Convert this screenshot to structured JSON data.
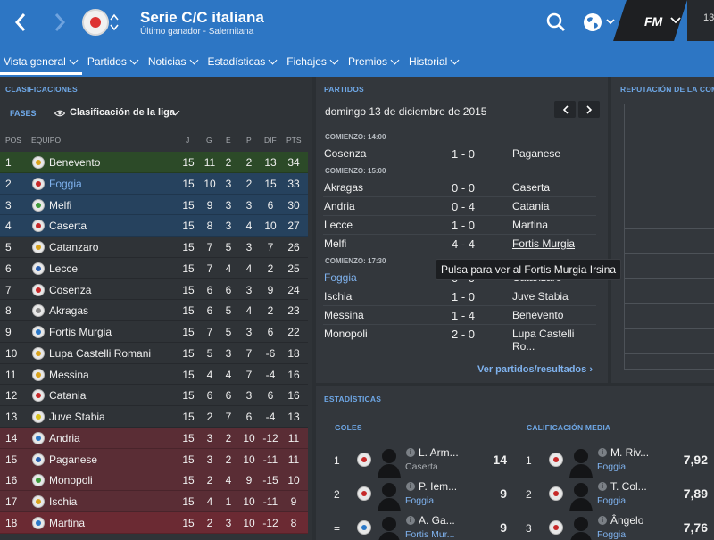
{
  "header": {
    "title": "Serie C/C italiana",
    "subtitle": "Último ganador - Salernitana",
    "fm_logo": "FM",
    "right_number": "13",
    "back_icon": "chevron-left-icon",
    "forward_icon": "chevron-right-icon",
    "search_icon": "search-icon",
    "globe_icon": "globe-icon",
    "accent_color": "#2d76c4"
  },
  "tabs": [
    {
      "label": "Vista general",
      "active": true
    },
    {
      "label": "Partidos",
      "active": false
    },
    {
      "label": "Noticias",
      "active": false
    },
    {
      "label": "Estadísticas",
      "active": false
    },
    {
      "label": "Fichajes",
      "active": false
    },
    {
      "label": "Premios",
      "active": false
    },
    {
      "label": "Historial",
      "active": false
    }
  ],
  "standings": {
    "heading": "CLASIFICACIONES",
    "fases_label": "FASES",
    "selector_label": "Clasificación de la liga",
    "columns": {
      "pos": "POS",
      "team": "EQUIPO",
      "j": "J",
      "g": "G",
      "e": "E",
      "p": "P",
      "dif": "DIF",
      "pts": "PTS"
    },
    "rows": [
      {
        "pos": "1",
        "team": "Benevento",
        "j": "15",
        "g": "11",
        "e": "2",
        "p": "2",
        "dif": "13",
        "pts": "34",
        "zone": "promo",
        "team_color": "#d9a21c",
        "link": false
      },
      {
        "pos": "2",
        "team": "Foggia",
        "j": "15",
        "g": "10",
        "e": "3",
        "p": "2",
        "dif": "15",
        "pts": "33",
        "zone": "playoff",
        "team_color": "#c62828",
        "link": true
      },
      {
        "pos": "3",
        "team": "Melfi",
        "j": "15",
        "g": "9",
        "e": "3",
        "p": "3",
        "dif": "6",
        "pts": "30",
        "zone": "playoff",
        "team_color": "#3f9a3a",
        "link": false
      },
      {
        "pos": "4",
        "team": "Caserta",
        "j": "15",
        "g": "8",
        "e": "3",
        "p": "4",
        "dif": "10",
        "pts": "27",
        "zone": "playoff",
        "team_color": "#c62828",
        "link": false
      },
      {
        "pos": "5",
        "team": "Catanzaro",
        "j": "15",
        "g": "7",
        "e": "5",
        "p": "3",
        "dif": "7",
        "pts": "26",
        "zone": "normal",
        "team_color": "#d9a21c",
        "link": false
      },
      {
        "pos": "6",
        "team": "Lecce",
        "j": "15",
        "g": "7",
        "e": "4",
        "p": "4",
        "dif": "2",
        "pts": "25",
        "zone": "normal",
        "team_color": "#2a5fb0",
        "link": false
      },
      {
        "pos": "7",
        "team": "Cosenza",
        "j": "15",
        "g": "6",
        "e": "6",
        "p": "3",
        "dif": "9",
        "pts": "24",
        "zone": "normal",
        "team_color": "#c62828",
        "link": false
      },
      {
        "pos": "8",
        "team": "Akragas",
        "j": "15",
        "g": "6",
        "e": "5",
        "p": "4",
        "dif": "2",
        "pts": "23",
        "zone": "normal",
        "team_color": "#888888",
        "link": false
      },
      {
        "pos": "9",
        "team": "Fortis Murgia",
        "j": "15",
        "g": "7",
        "e": "5",
        "p": "3",
        "dif": "6",
        "pts": "22",
        "zone": "normal",
        "team_color": "#2a78c8",
        "link": false
      },
      {
        "pos": "10",
        "team": "Lupa Castelli Romani",
        "j": "15",
        "g": "5",
        "e": "3",
        "p": "7",
        "dif": "-6",
        "pts": "18",
        "zone": "normal",
        "team_color": "#d9a21c",
        "link": false
      },
      {
        "pos": "11",
        "team": "Messina",
        "j": "15",
        "g": "4",
        "e": "4",
        "p": "7",
        "dif": "-4",
        "pts": "16",
        "zone": "normal",
        "team_color": "#d9a21c",
        "link": false
      },
      {
        "pos": "12",
        "team": "Catania",
        "j": "15",
        "g": "6",
        "e": "6",
        "p": "3",
        "dif": "6",
        "pts": "16",
        "zone": "normal",
        "team_color": "#c62828",
        "link": false
      },
      {
        "pos": "13",
        "team": "Juve Stabia",
        "j": "15",
        "g": "2",
        "e": "7",
        "p": "6",
        "dif": "-4",
        "pts": "13",
        "zone": "normal",
        "team_color": "#d9c21c",
        "link": false
      },
      {
        "pos": "14",
        "team": "Andria",
        "j": "15",
        "g": "3",
        "e": "2",
        "p": "10",
        "dif": "-12",
        "pts": "11",
        "zone": "rel",
        "team_color": "#2a78c8",
        "link": false
      },
      {
        "pos": "15",
        "team": "Paganese",
        "j": "15",
        "g": "3",
        "e": "2",
        "p": "10",
        "dif": "-11",
        "pts": "11",
        "zone": "rel",
        "team_color": "#2a5fb0",
        "link": false
      },
      {
        "pos": "16",
        "team": "Monopoli",
        "j": "15",
        "g": "2",
        "e": "4",
        "p": "9",
        "dif": "-15",
        "pts": "10",
        "zone": "rel",
        "team_color": "#3f9a3a",
        "link": false
      },
      {
        "pos": "17",
        "team": "Ischia",
        "j": "15",
        "g": "4",
        "e": "1",
        "p": "10",
        "dif": "-11",
        "pts": "9",
        "zone": "rel",
        "team_color": "#d9a21c",
        "link": false
      },
      {
        "pos": "18",
        "team": "Martina",
        "j": "15",
        "g": "2",
        "e": "3",
        "p": "10",
        "dif": "-12",
        "pts": "8",
        "zone": "rel2",
        "team_color": "#2a78c8",
        "link": false
      }
    ]
  },
  "matches": {
    "heading": "PARTIDOS",
    "date": "domingo 13 de diciembre de 2015",
    "groups": [
      {
        "kickoff": "COMIENZO: 14:00",
        "games": [
          {
            "home": "Cosenza",
            "score": "1 - 0",
            "away": "Paganese"
          }
        ]
      },
      {
        "kickoff": "COMIENZO: 15:00",
        "games": [
          {
            "home": "Akragas",
            "score": "0 - 0",
            "away": "Caserta"
          },
          {
            "home": "Andria",
            "score": "0 - 4",
            "away": "Catania"
          },
          {
            "home": "Lecce",
            "score": "1 - 0",
            "away": "Martina"
          },
          {
            "home": "Melfi",
            "score": "4 - 4",
            "away": "Fortis Murgia"
          }
        ]
      },
      {
        "kickoff": "COMIENZO: 17:30",
        "games": [
          {
            "home": "Foggia",
            "score": "0 - 0",
            "away": "Catanzaro"
          },
          {
            "home": "Ischia",
            "score": "1 - 0",
            "away": "Juve Stabia"
          },
          {
            "home": "Messina",
            "score": "1 - 4",
            "away": "Benevento"
          },
          {
            "home": "Monopoli",
            "score": "2 - 0",
            "away": "Lupa Castelli Ro..."
          }
        ]
      }
    ],
    "tooltip": "Pulsa para ver al Fortis Murgia Irsina",
    "view_all": "Ver partidos/resultados"
  },
  "reputation": {
    "heading": "REPUTACIÓN DE LA COMP"
  },
  "stats": {
    "heading": "ESTADÍSTICAS",
    "goals": {
      "heading": "GOLES",
      "rows": [
        {
          "rank": "1",
          "name": "L. Arm...",
          "club": "Caserta",
          "value": "14",
          "club_link": false,
          "team_color": "#c62828"
        },
        {
          "rank": "2",
          "name": "P. Iem...",
          "club": "Foggia",
          "value": "9",
          "club_link": true,
          "team_color": "#c62828"
        },
        {
          "rank": "=",
          "name": "A. Ga...",
          "club": "Fortis Mur...",
          "value": "9",
          "club_link": true,
          "team_color": "#2a78c8"
        }
      ]
    },
    "rating": {
      "heading": "CALIFICACIÓN MEDIA",
      "rows": [
        {
          "rank": "1",
          "name": "M. Riv...",
          "club": "Foggia",
          "value": "7,92",
          "club_link": true,
          "team_color": "#c62828"
        },
        {
          "rank": "2",
          "name": "T. Col...",
          "club": "Foggia",
          "value": "7,89",
          "club_link": true,
          "team_color": "#c62828"
        },
        {
          "rank": "3",
          "name": "Ângelo",
          "club": "Foggia",
          "value": "7,76",
          "club_link": true,
          "team_color": "#c62828"
        }
      ]
    }
  }
}
